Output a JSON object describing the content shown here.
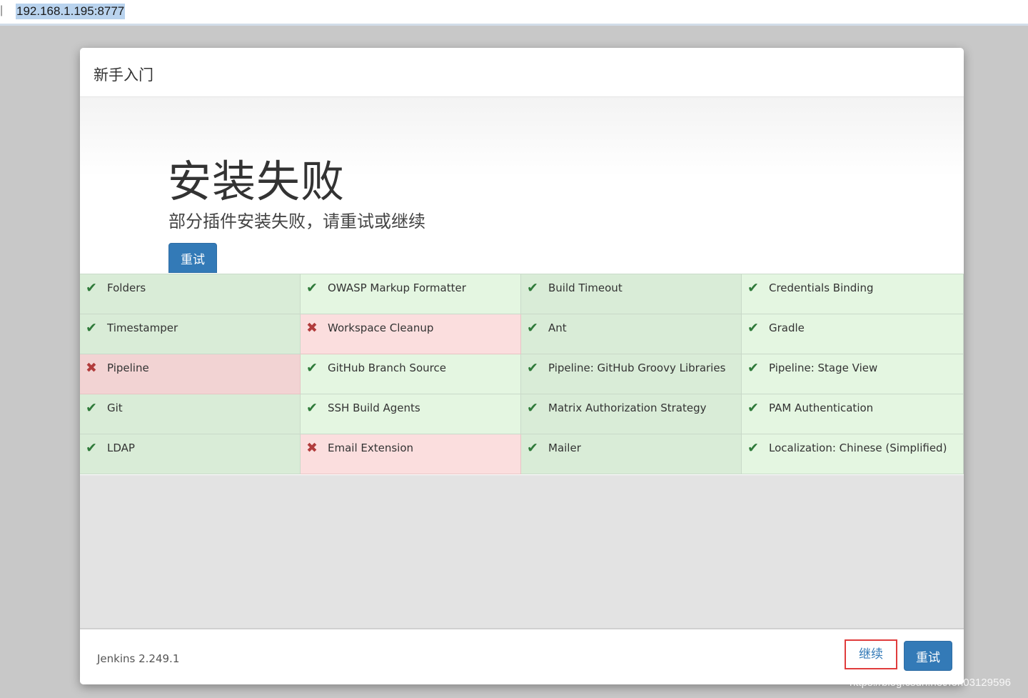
{
  "browser": {
    "url": "192.168.1.195:8777"
  },
  "dialog": {
    "title": "新手入门",
    "heading": "安装失败",
    "subheading": "部分插件安装失败，请重试或继续",
    "retry_label": "重试"
  },
  "plugins": [
    {
      "name": "Folders",
      "status": "success"
    },
    {
      "name": "OWASP Markup Formatter",
      "status": "success"
    },
    {
      "name": "Build Timeout",
      "status": "success"
    },
    {
      "name": "Credentials Binding",
      "status": "success"
    },
    {
      "name": "Timestamper",
      "status": "success"
    },
    {
      "name": "Workspace Cleanup",
      "status": "failed"
    },
    {
      "name": "Ant",
      "status": "success"
    },
    {
      "name": "Gradle",
      "status": "success"
    },
    {
      "name": "Pipeline",
      "status": "failed"
    },
    {
      "name": "GitHub Branch Source",
      "status": "success"
    },
    {
      "name": "Pipeline: GitHub Groovy Libraries",
      "status": "success"
    },
    {
      "name": "Pipeline: Stage View",
      "status": "success"
    },
    {
      "name": "Git",
      "status": "success"
    },
    {
      "name": "SSH Build Agents",
      "status": "success"
    },
    {
      "name": "Matrix Authorization Strategy",
      "status": "success"
    },
    {
      "name": "PAM Authentication",
      "status": "success"
    },
    {
      "name": "LDAP",
      "status": "success"
    },
    {
      "name": "Email Extension",
      "status": "failed"
    },
    {
      "name": "Mailer",
      "status": "success"
    },
    {
      "name": "Localization: Chinese (Simplified)",
      "status": "success"
    }
  ],
  "status_icons": {
    "success": "✔",
    "failed": "✖"
  },
  "footer": {
    "version": "Jenkins 2.249.1",
    "continue_label": "继续",
    "retry_label": "重试"
  },
  "watermark": "https://blog.csdn.net/fon03129596",
  "colors": {
    "primary": "#337ab7",
    "success_bg": "#d9ecd7",
    "failed_bg": "#f2d3d3",
    "highlight": "#e03c3c"
  }
}
